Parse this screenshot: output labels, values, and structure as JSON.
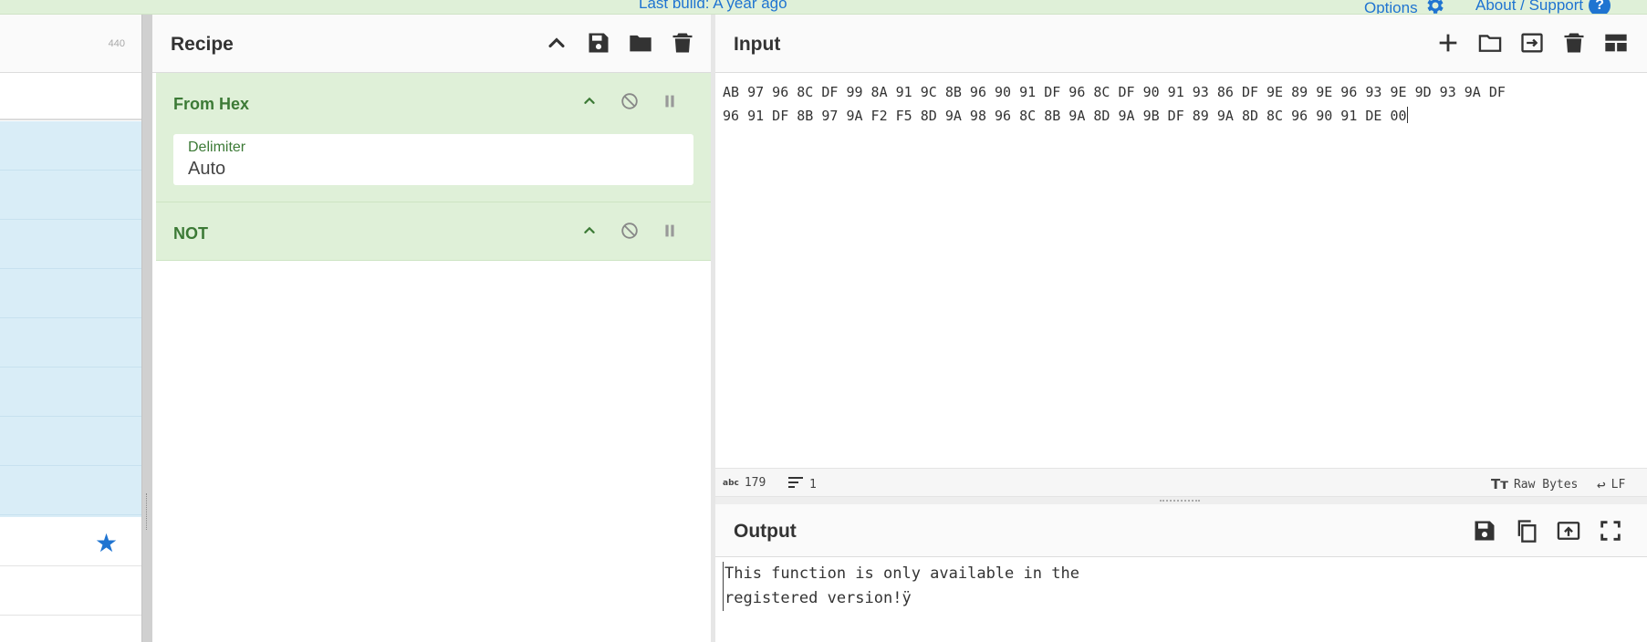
{
  "banner": {
    "last_build": "Last build: A year ago",
    "options_label": "Options",
    "about_label": "About / Support",
    "help_glyph": "?"
  },
  "operations": {
    "count": "440",
    "favourites_icon": "star-icon"
  },
  "recipe": {
    "title": "Recipe",
    "controls": [
      "chevron-up-icon",
      "save-icon",
      "folder-icon",
      "trash-icon"
    ],
    "ops": [
      {
        "name": "From Hex",
        "args": [
          {
            "label": "Delimiter",
            "value": "Auto"
          }
        ]
      },
      {
        "name": "NOT",
        "args": []
      }
    ]
  },
  "input": {
    "title": "Input",
    "text": "AB 97 96 8C DF 99 8A 91 9C 8B 96 90 91 DF 96 8C DF 90 91 93 86 DF 9E 89 9E 96 93 9E 9D 93 9A DF\n96 91 DF 8B 97 9A F2 F5 8D 9A 98 96 8C 8B 9A 8D 9A 9B DF 89 9A 8D 8C 96 90 91 DE 00",
    "status": {
      "chars": "179",
      "lines": "1",
      "abc_glyph": "abc",
      "encoding": "Raw Bytes",
      "eol": "LF"
    }
  },
  "output": {
    "title": "Output",
    "text": "This function is only available in the\nregistered version!ÿ"
  },
  "colors": {
    "accent": "#1f74d1",
    "recipe_op_bg": "#dff0d8",
    "recipe_op_text": "#3c7a36",
    "ops_highlight": "#d9edf7"
  }
}
